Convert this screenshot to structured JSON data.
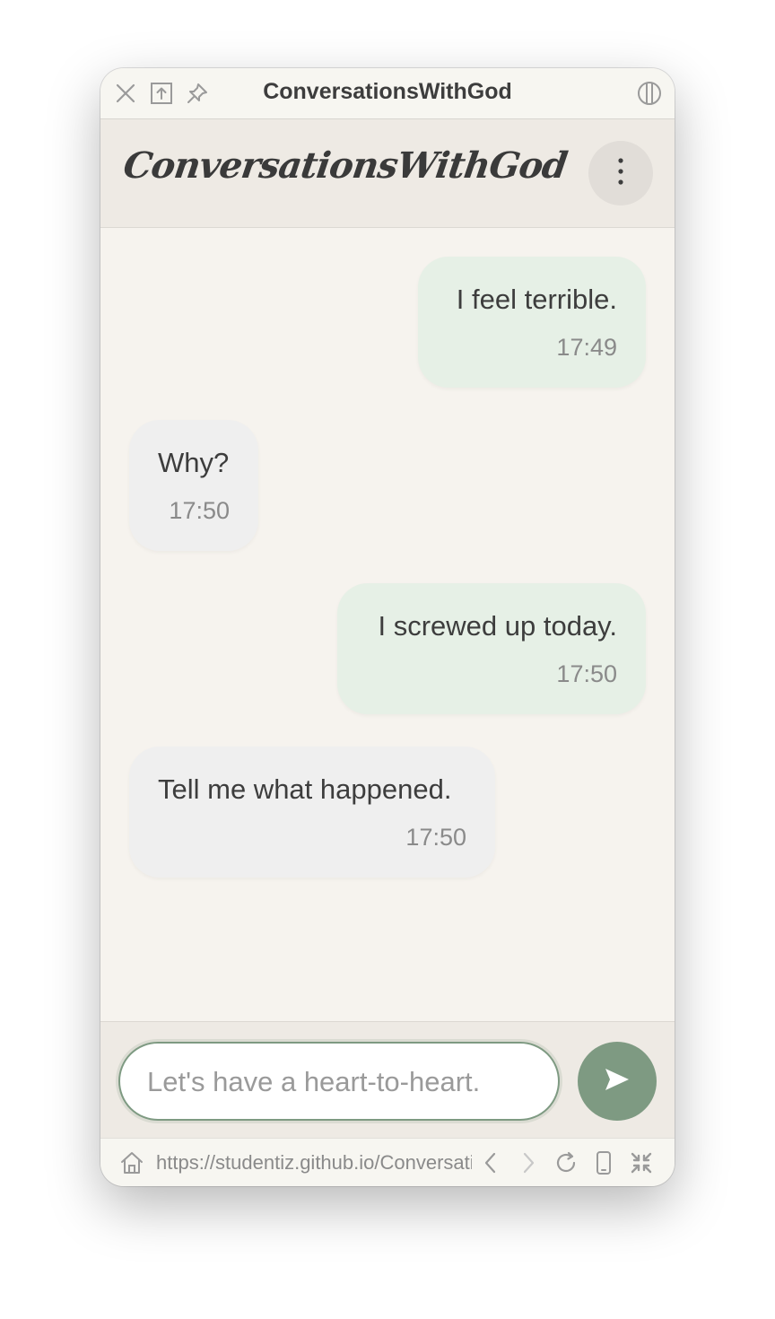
{
  "window": {
    "title": "ConversationsWithGod"
  },
  "header": {
    "logo_text": "ConversationsWithGod",
    "menu_icon": "more-vertical-icon"
  },
  "messages": [
    {
      "sender": "user",
      "text": "I feel terrible.",
      "time": "17:49"
    },
    {
      "sender": "bot",
      "text": "Why?",
      "time": "17:50"
    },
    {
      "sender": "user",
      "text": "I screwed up today.",
      "time": "17:50"
    },
    {
      "sender": "bot",
      "text": "Tell me what happened.",
      "time": "17:50"
    }
  ],
  "composer": {
    "value": "",
    "placeholder": "Let's have a heart-to-heart.",
    "send_icon": "send-arrow-icon"
  },
  "browser_bar": {
    "url": "https://studentiz.github.io/ConversationsWithGod"
  },
  "colors": {
    "accent": "#7e9a82",
    "user_bubble": "#e6f0e6",
    "bot_bubble": "#efefef",
    "background": "#f6f3ee",
    "header": "#eeeae4"
  }
}
